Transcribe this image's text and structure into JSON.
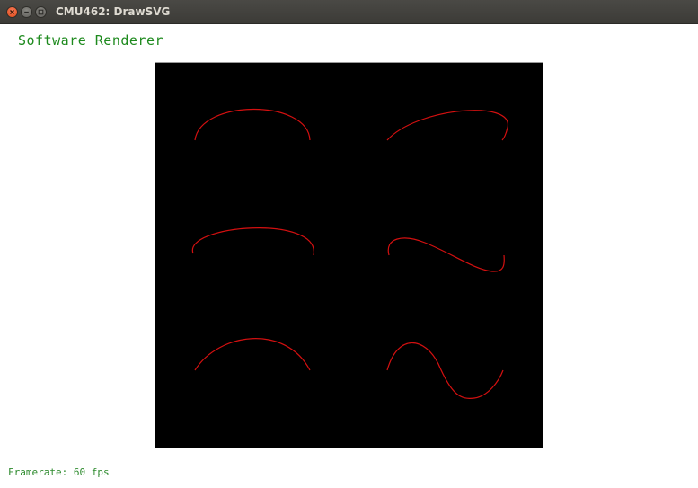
{
  "window": {
    "title": "CMU462: DrawSVG"
  },
  "app": {
    "heading": "Software Renderer"
  },
  "status": {
    "framerate_label": "Framerate:",
    "framerate_value": "60 fps"
  },
  "colors": {
    "canvas_background": "#000000",
    "stroke": "#d41010",
    "text_accent": "#1e8a1e"
  },
  "icons": {
    "close": "close-icon",
    "minimize": "minimize-icon",
    "maximize": "maximize-icon"
  }
}
